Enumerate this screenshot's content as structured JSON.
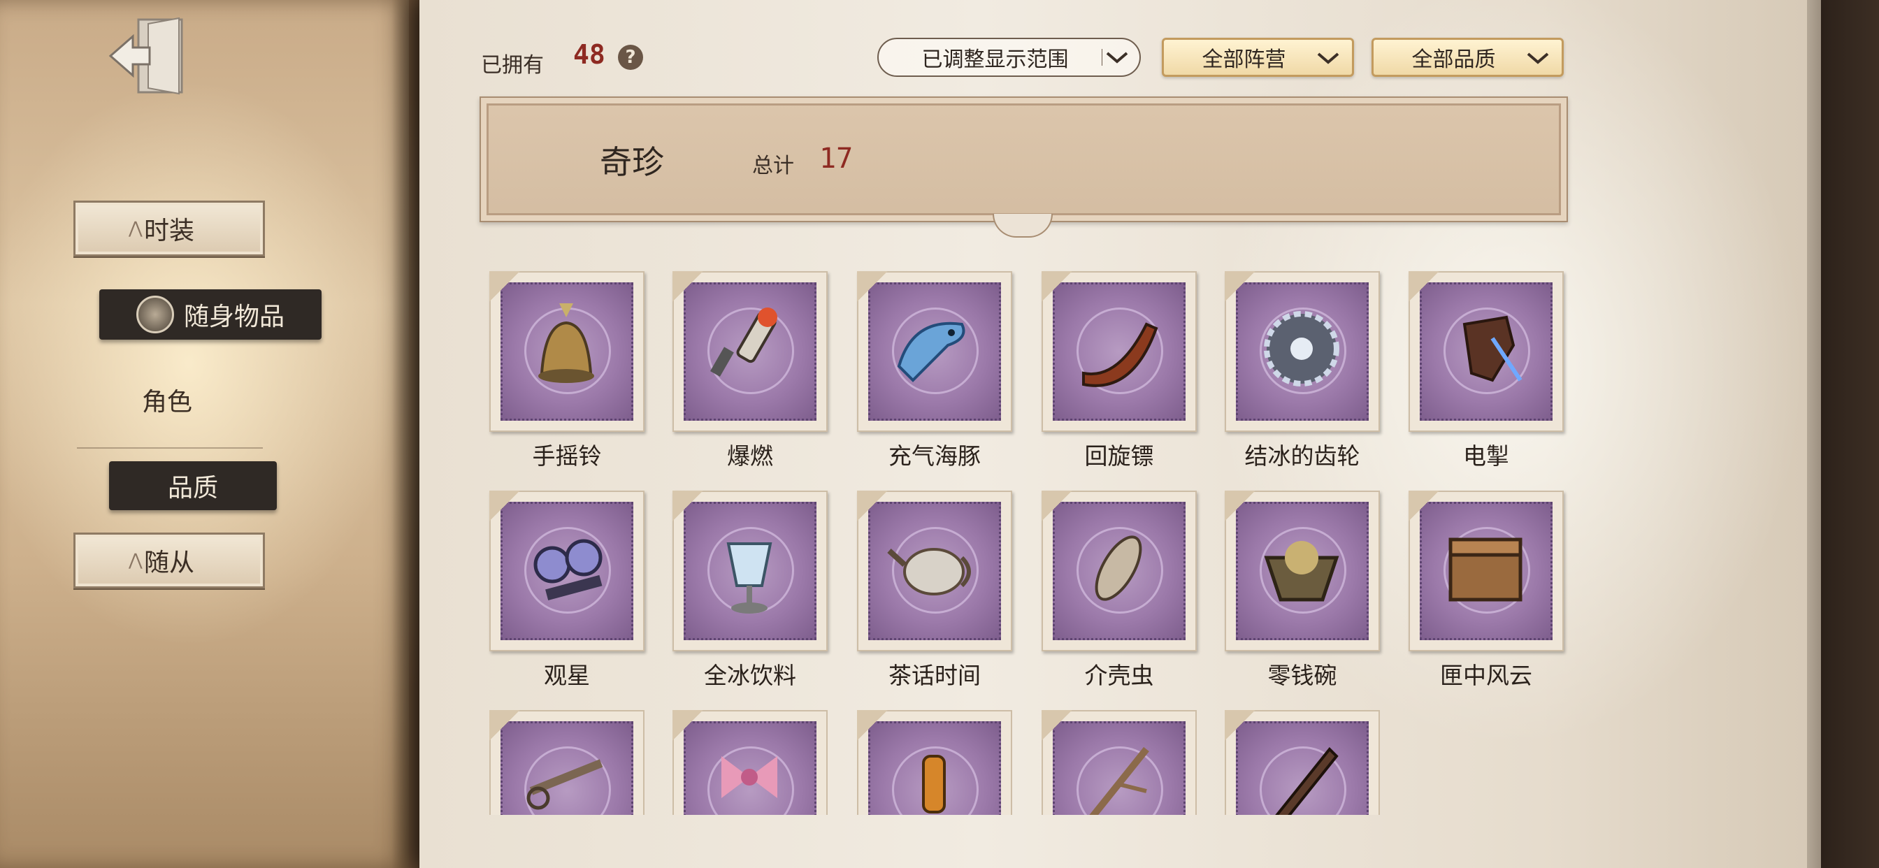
{
  "sidebar": {
    "exit_icon": "exit-door-icon",
    "items": [
      {
        "label": "时装",
        "style": "framed"
      },
      {
        "label": "随身物品",
        "style": "selected"
      },
      {
        "label": "角色",
        "style": "plain"
      },
      {
        "label": "品质",
        "style": "dark"
      },
      {
        "label": "随从",
        "style": "framed"
      }
    ]
  },
  "header": {
    "owned_label": "已拥有",
    "owned_count": "48",
    "help_icon": "question-mark-icon",
    "range_filter": "已调整显示范围",
    "faction_filter": "全部阵营",
    "quality_filter": "全部品质"
  },
  "category": {
    "name": "奇珍",
    "total_label": "总计",
    "total": "17"
  },
  "items": [
    {
      "label": "手摇铃",
      "icon": "hand-bell-icon"
    },
    {
      "label": "爆燃",
      "icon": "spark-plug-icon"
    },
    {
      "label": "充气海豚",
      "icon": "inflatable-dolphin-icon"
    },
    {
      "label": "回旋镖",
      "icon": "boomerang-icon"
    },
    {
      "label": "结冰的齿轮",
      "icon": "frozen-gear-icon"
    },
    {
      "label": "电掣",
      "icon": "electric-glove-icon"
    },
    {
      "label": "观星",
      "icon": "binoculars-icon"
    },
    {
      "label": "全冰饮料",
      "icon": "ice-drink-icon"
    },
    {
      "label": "茶话时间",
      "icon": "teapot-icon"
    },
    {
      "label": "介壳虫",
      "icon": "insect-icon"
    },
    {
      "label": "零钱碗",
      "icon": "coin-bowl-icon"
    },
    {
      "label": "匣中风云",
      "icon": "treasure-box-icon"
    },
    {
      "label": "",
      "icon": "scissors-icon"
    },
    {
      "label": "",
      "icon": "bow-gift-icon"
    },
    {
      "label": "",
      "icon": "bottle-icon"
    },
    {
      "label": "",
      "icon": "branch-icon"
    },
    {
      "label": "",
      "icon": "blade-icon"
    }
  ],
  "colors": {
    "accent_red": "#8e2a22",
    "stamp_purple": "#9c7aaa",
    "filter_gold": "#f0d9a7"
  }
}
